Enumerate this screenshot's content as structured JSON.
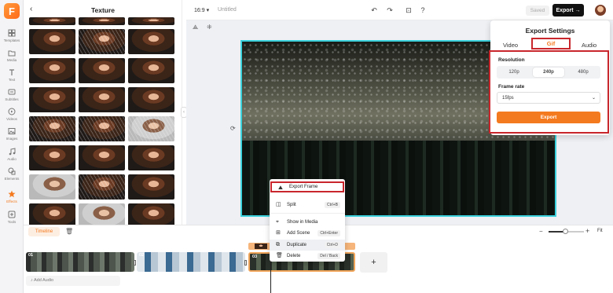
{
  "rail": {
    "logo": "F",
    "items": [
      {
        "label": "Templates",
        "icon": "templates-icon"
      },
      {
        "label": "Media",
        "icon": "folder-icon"
      },
      {
        "label": "Text",
        "icon": "text-icon"
      },
      {
        "label": "Subtitles",
        "icon": "subtitles-icon"
      },
      {
        "label": "Videos",
        "icon": "videos-icon"
      },
      {
        "label": "Images",
        "icon": "image-icon"
      },
      {
        "label": "Audio",
        "icon": "music-icon"
      },
      {
        "label": "Elements",
        "icon": "elements-icon"
      },
      {
        "label": "Effects",
        "icon": "effects-icon"
      },
      {
        "label": "Tools",
        "icon": "tools-icon"
      }
    ],
    "active": "Effects",
    "accent": "#f47a1f"
  },
  "panel": {
    "title": "Texture",
    "back_icon": "chevron-left-icon"
  },
  "topbar": {
    "ratio": "16:9 ▾",
    "project": "Untitled",
    "saved": "Saved",
    "export": "Export →"
  },
  "export_settings": {
    "title": "Export Settings",
    "tabs": [
      "Video",
      "Gif",
      "Audio"
    ],
    "selected_tab": "Gif",
    "resolution_label": "Resolution",
    "resolutions": [
      "120p",
      "240p",
      "480p"
    ],
    "selected_resolution": "240p",
    "frame_rate_label": "Frame rate",
    "frame_rate": "15fps",
    "export_button": "Export"
  },
  "context_menu": {
    "items": [
      {
        "label": "Export Frame",
        "shortcut": "",
        "icon": "export-frame-icon"
      },
      {
        "label": "Split",
        "shortcut": "Ctrl+B",
        "icon": "split-icon"
      },
      {
        "label": "Show in Media",
        "shortcut": "",
        "icon": "location-icon"
      },
      {
        "label": "Add Scene",
        "shortcut": "Ctrl+Enter",
        "icon": "add-scene-icon"
      },
      {
        "label": "Duplicate",
        "shortcut": "Ctrl+D",
        "icon": "duplicate-icon"
      },
      {
        "label": "Delete",
        "shortcut": "Del / Back",
        "icon": "trash-icon"
      }
    ],
    "highlight_color": "#c8262c"
  },
  "timeline": {
    "label": "Timeline",
    "fit": "Fit",
    "zoom_level": 0.45,
    "clips": [
      "01",
      "02",
      "03"
    ],
    "add_audio": "Add Audio"
  }
}
